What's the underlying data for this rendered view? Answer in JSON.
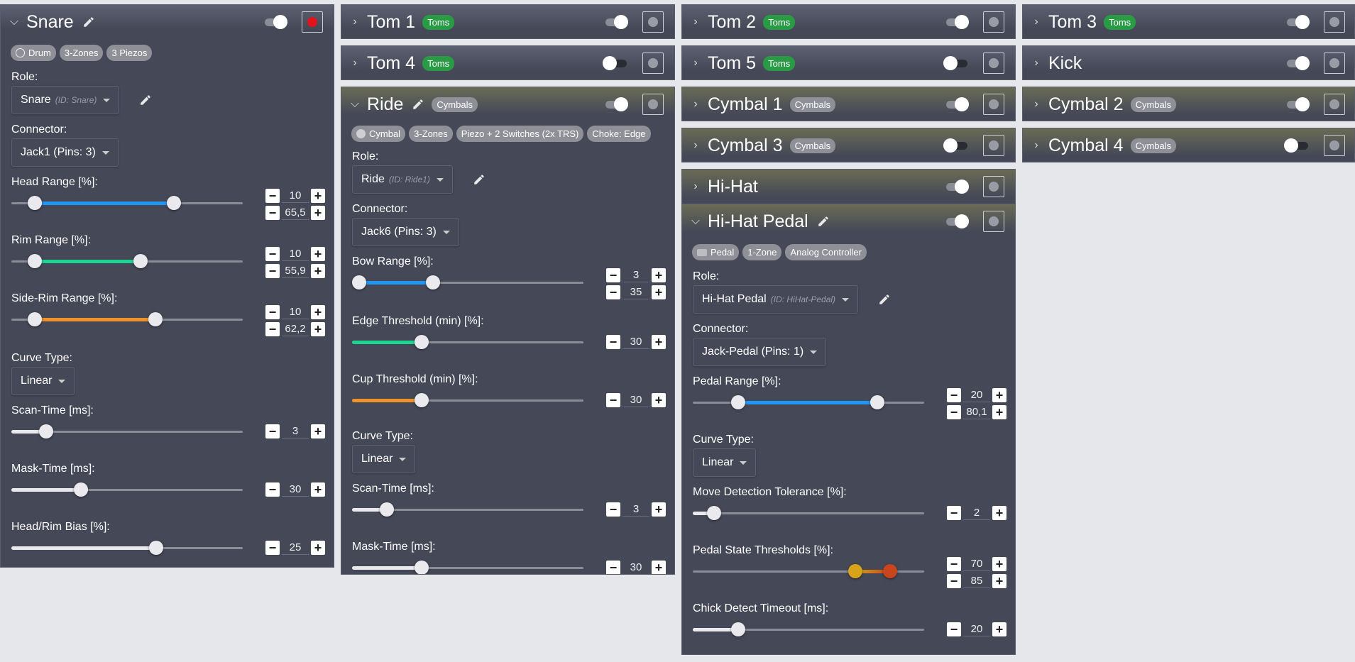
{
  "colors": {
    "panel": "#454857",
    "toms_badge": "#2a9b45",
    "cymbals_badge": "#8e8f97",
    "blue": "#2196f3",
    "green": "#1fd392",
    "orange": "#f0922a",
    "red_indicator": "#e1141c"
  },
  "snare": {
    "title": "Snare",
    "chips": [
      "Drum",
      "3-Zones",
      "3 Piezos"
    ],
    "role_label": "Role:",
    "role_value": "Snare",
    "role_id": "(ID: Snare)",
    "connector_label": "Connector:",
    "connector_value": "Jack1 (Pins: 3)",
    "head_label": "Head Range [%]:",
    "head_min": "10",
    "head_max": "65,5",
    "rim_label": "Rim Range [%]:",
    "rim_min": "10",
    "rim_max": "55,9",
    "siderim_label": "Side-Rim Range [%]:",
    "siderim_min": "10",
    "siderim_max": "62,2",
    "curve_label": "Curve Type:",
    "curve_value": "Linear",
    "scan_label": "Scan-Time [ms]:",
    "scan_value": "3",
    "mask_label": "Mask-Time [ms]:",
    "mask_value": "30",
    "bias_label": "Head/Rim Bias [%]:",
    "bias_value": "25",
    "toggle_on": true
  },
  "tom1": {
    "title": "Tom 1",
    "badge": "Toms",
    "toggle_on": true
  },
  "tom2": {
    "title": "Tom 2",
    "badge": "Toms",
    "toggle_on": true
  },
  "tom3": {
    "title": "Tom 3",
    "badge": "Toms",
    "toggle_on": true
  },
  "tom4": {
    "title": "Tom 4",
    "badge": "Toms",
    "toggle_on": false
  },
  "tom5": {
    "title": "Tom 5",
    "badge": "Toms",
    "toggle_on": false
  },
  "kick": {
    "title": "Kick",
    "toggle_on": true
  },
  "cymbal1": {
    "title": "Cymbal 1",
    "badge": "Cymbals",
    "toggle_on": true
  },
  "cymbal2": {
    "title": "Cymbal 2",
    "badge": "Cymbals",
    "toggle_on": true
  },
  "cymbal3": {
    "title": "Cymbal 3",
    "badge": "Cymbals",
    "toggle_on": false
  },
  "cymbal4": {
    "title": "Cymbal 4",
    "badge": "Cymbals",
    "toggle_on": false
  },
  "hihat": {
    "title": "Hi-Hat",
    "toggle_on": true
  },
  "ride": {
    "title": "Ride",
    "badge": "Cymbals",
    "chips": [
      "Cymbal",
      "3-Zones",
      "Piezo + 2 Switches (2x TRS)",
      "Choke: Edge"
    ],
    "role_label": "Role:",
    "role_value": "Ride",
    "role_id": "(ID: Ride1)",
    "connector_label": "Connector:",
    "connector_value": "Jack6 (Pins: 3)",
    "bow_label": "Bow Range [%]:",
    "bow_min": "3",
    "bow_max": "35",
    "edge_label": "Edge Threshold (min) [%]:",
    "edge_value": "30",
    "cup_label": "Cup Threshold (min) [%]:",
    "cup_value": "30",
    "curve_label": "Curve Type:",
    "curve_value": "Linear",
    "scan_label": "Scan-Time [ms]:",
    "scan_value": "3",
    "mask_label": "Mask-Time [ms]:",
    "mask_value": "30",
    "toggle_on": true
  },
  "hihatpedal": {
    "title": "Hi-Hat Pedal",
    "chips": [
      "Pedal",
      "1-Zone",
      "Analog Controller"
    ],
    "role_label": "Role:",
    "role_value": "Hi-Hat Pedal",
    "role_id": "(ID: HiHat-Pedal)",
    "connector_label": "Connector:",
    "connector_value": "Jack-Pedal (Pins: 1)",
    "range_label": "Pedal Range [%]:",
    "range_min": "20",
    "range_max": "80,1",
    "curve_label": "Curve Type:",
    "curve_value": "Linear",
    "move_label": "Move Detection Tolerance [%]:",
    "move_value": "2",
    "state_label": "Pedal State Thresholds [%]:",
    "state_min": "70",
    "state_max": "85",
    "chick_label": "Chick Detect Timeout [ms]:",
    "chick_value": "20",
    "toggle_on": true
  }
}
